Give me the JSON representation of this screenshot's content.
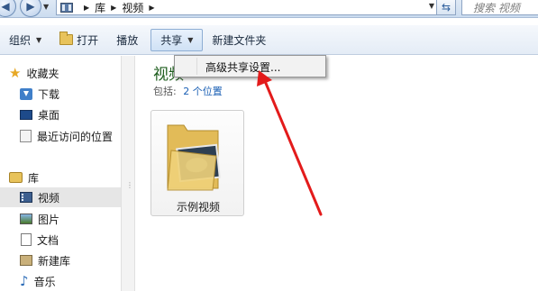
{
  "address": {
    "crumbs": [
      "库",
      "视频"
    ],
    "search_placeholder": "搜索 视频"
  },
  "toolbar": {
    "organize": "组织",
    "open": "打开",
    "play": "播放",
    "share": "共享",
    "new_folder": "新建文件夹"
  },
  "share_menu": {
    "item": "高级共享设置..."
  },
  "sidebar": {
    "favorites": "收藏夹",
    "favorites_items": [
      "下载",
      "桌面",
      "最近访问的位置"
    ],
    "libraries": "库",
    "library_items": [
      "视频",
      "图片",
      "文档",
      "新建库",
      "音乐"
    ]
  },
  "main": {
    "title": "视频",
    "includes_label": "包括:",
    "includes_link": "2 个位置",
    "items": [
      {
        "label": "示例视频"
      }
    ]
  },
  "colors": {
    "annotation_arrow": "#e31b1b",
    "library_title": "#1e5e1e",
    "link": "#1a5fb4"
  }
}
